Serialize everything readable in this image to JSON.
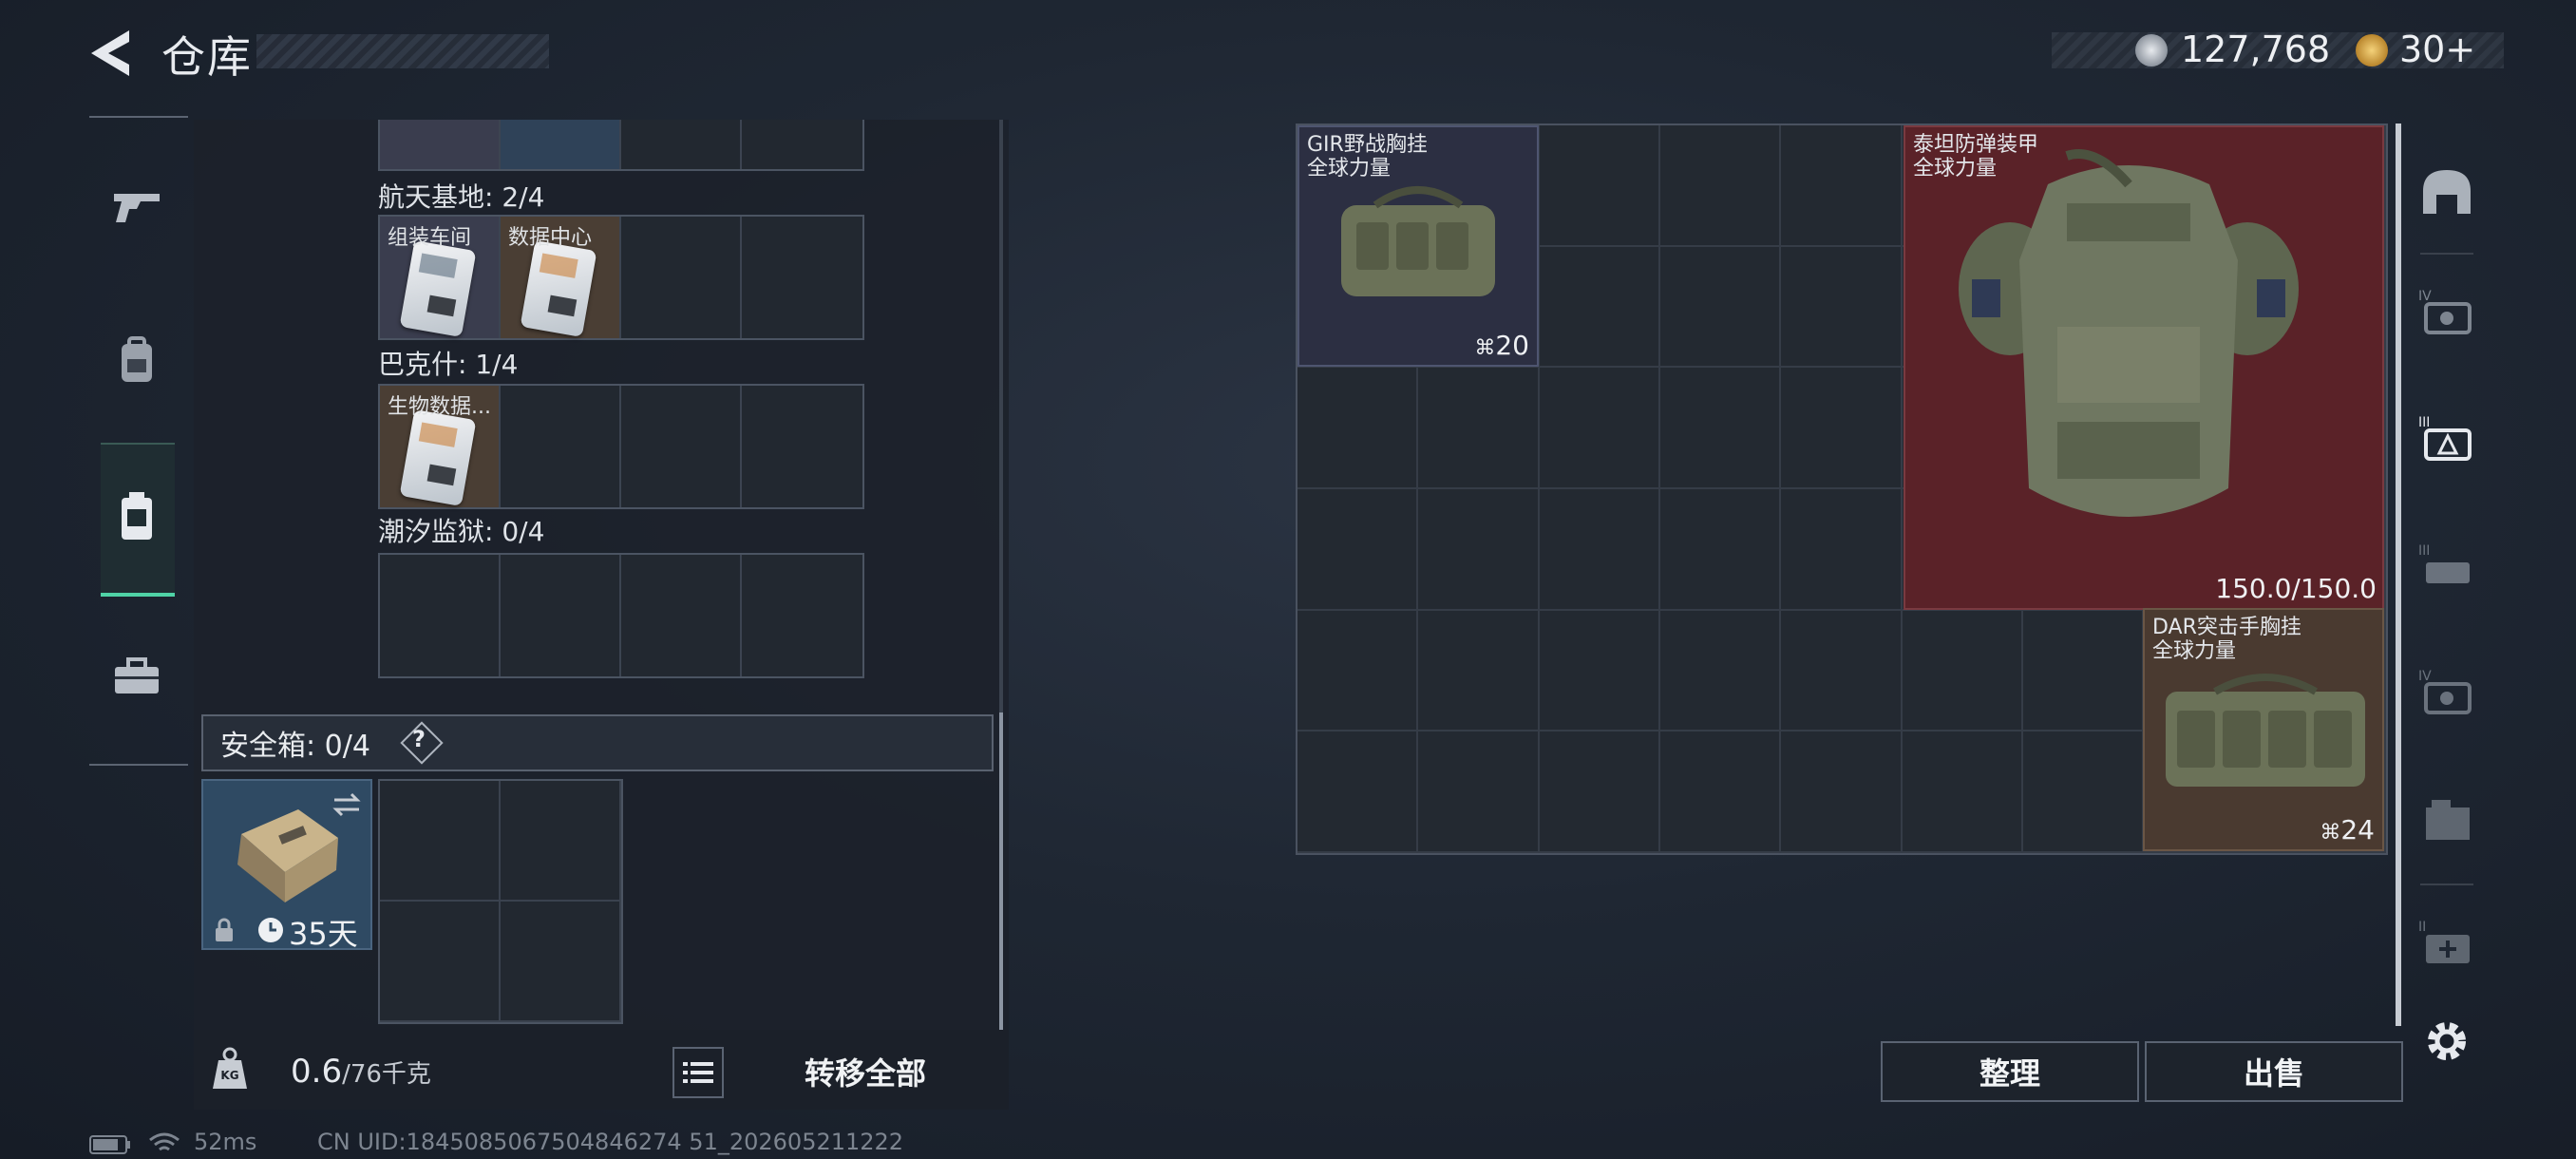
{
  "header": {
    "title": "仓库",
    "currency_primary": "127,768",
    "currency_secondary": "30+"
  },
  "left_panel": {
    "sections": [
      {
        "label": "航天基地: 2/4",
        "slots": [
          "组装车间",
          "数据中心",
          "",
          ""
        ]
      },
      {
        "label": "巴克什: 1/4",
        "slots": [
          "生物数据...",
          "",
          "",
          ""
        ]
      },
      {
        "label": "潮汐监狱: 0/4",
        "slots": [
          "",
          "",
          "",
          ""
        ]
      }
    ],
    "safe_box": {
      "label": "安全箱: 0/4",
      "help": "?",
      "duration": "35天"
    },
    "footer": {
      "weight_current": "0.6",
      "weight_max": "/76千克",
      "transfer_all": "转移全部"
    }
  },
  "inventory": {
    "items": [
      {
        "name_line1": "GIR野战胸挂",
        "name_line2": "全球力量",
        "count": "20",
        "color": "#2c2f42"
      },
      {
        "name_line1": "泰坦防弹装甲",
        "name_line2": "全球力量",
        "durability": "150.0/150.0",
        "color": "#5a2228"
      },
      {
        "name_line1": "DAR突击手胸挂",
        "name_line2": "全球力量",
        "count": "24",
        "color": "#4a3a30"
      }
    ],
    "buttons": {
      "sort": "整理",
      "sell": "出售"
    }
  },
  "status_bar": {
    "ping": "52ms",
    "uid": "CN UID:1845085067504846274 51_202605211222"
  },
  "colors": {
    "accent": "#4fd3a6",
    "armor_bg": "#5a2228"
  }
}
